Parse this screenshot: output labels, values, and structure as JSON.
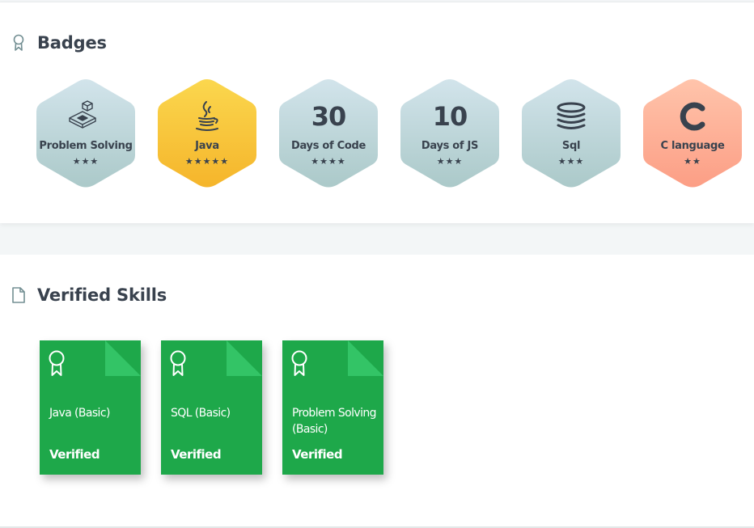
{
  "badges_section": {
    "title": "Badges",
    "icon": "award-ribbon-icon",
    "items": [
      {
        "name": "Problem Solving",
        "icon": "problem-solving-icon",
        "stars": "★★★",
        "star_count": 3,
        "color": "light-blue"
      },
      {
        "name": "Java",
        "icon": "java-coffee-icon",
        "stars": "★★★★★",
        "star_count": 5,
        "color": "gold"
      },
      {
        "name": "Days of Code",
        "number": "30",
        "stars": "★★★★",
        "star_count": 4,
        "color": "light-blue"
      },
      {
        "name": "Days of JS",
        "number": "10",
        "stars": "★★★",
        "star_count": 3,
        "color": "light-blue"
      },
      {
        "name": "Sql",
        "icon": "database-icon",
        "stars": "★★★",
        "star_count": 3,
        "color": "light-blue"
      },
      {
        "name": "C language",
        "icon": "c-letter-icon",
        "stars": "★★",
        "star_count": 2,
        "color": "salmon"
      }
    ]
  },
  "skills_section": {
    "title": "Verified Skills",
    "icon": "document-icon",
    "items": [
      {
        "name": "Java (Basic)",
        "status": "Verified"
      },
      {
        "name": "SQL (Basic)",
        "status": "Verified"
      },
      {
        "name": "Problem Solving (Basic)",
        "status": "Verified"
      }
    ]
  },
  "colors": {
    "text_dark": "#39424e",
    "skill_green": "#1ea84a",
    "skill_fold": "#33c466",
    "badge_blue_top": "#cfe2e9",
    "badge_blue_bottom": "#aecbcb",
    "badge_gold_top": "#fbd44b",
    "badge_gold_bottom": "#f6b72c",
    "badge_salmon_top": "#ffc1a8",
    "badge_salmon_bottom": "#fd9f86"
  }
}
